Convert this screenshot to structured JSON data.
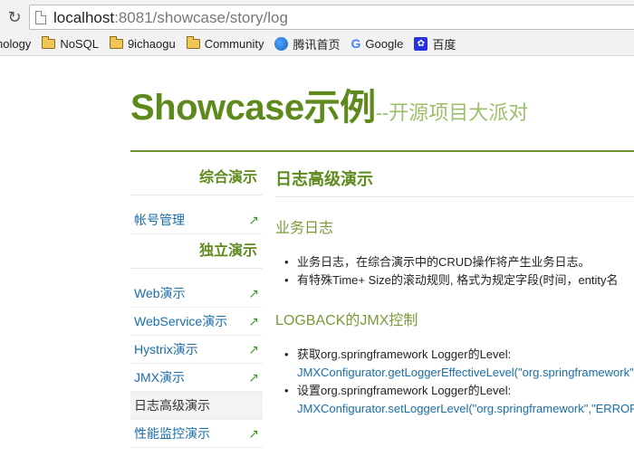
{
  "browser": {
    "url_host": "localhost",
    "url_rest": ":8081/showcase/story/log",
    "bookmarks": [
      {
        "label": "nology",
        "icon": "none"
      },
      {
        "label": "NoSQL",
        "icon": "folder-icon"
      },
      {
        "label": "9ichaogu",
        "icon": "folder-icon"
      },
      {
        "label": "Community",
        "icon": "folder-icon"
      },
      {
        "label": "腾讯首页",
        "icon": "tencent-icon"
      },
      {
        "label": "Google",
        "icon": "google-icon"
      },
      {
        "label": "百度",
        "icon": "baidu-icon"
      }
    ]
  },
  "header": {
    "logo_main": "Showcase示例",
    "logo_sub": "--开源项目大派对"
  },
  "sidebar": {
    "group1_title": "综合演示",
    "group1_items": [
      {
        "label": "帐号管理",
        "arrow": "↗"
      }
    ],
    "group2_title": "独立演示",
    "group2_items": [
      {
        "label": "Web演示",
        "arrow": "↗"
      },
      {
        "label": "WebService演示",
        "arrow": "↗"
      },
      {
        "label": "Hystrix演示",
        "arrow": "↗"
      },
      {
        "label": "JMX演示",
        "arrow": "↗"
      },
      {
        "label": "日志高级演示",
        "arrow": ""
      },
      {
        "label": "性能监控演示",
        "arrow": "↗"
      }
    ]
  },
  "content": {
    "title": "日志高级演示",
    "section1_title": "业务日志",
    "section1_items": [
      "业务日志，在综合演示中的CRUD操作将产生业务日志。",
      "有特殊Time+ Size的滚动规则, 格式为规定字段(时间，entity名"
    ],
    "section2_title": "LOGBACK的JMX控制",
    "section2_items": [
      {
        "text": "获取org.springframework Logger的Level:",
        "code": "JMXConfigurator.getLoggerEffectiveLevel(\"org.springframework\")"
      },
      {
        "text": "设置org.springframework Logger的Level:",
        "code": "JMXConfigurator.setLoggerLevel(\"org.springframework\",\"ERROR\")"
      }
    ]
  },
  "colors": {
    "brand_green": "#5e8a1d",
    "link_blue": "#1a6ea8"
  }
}
